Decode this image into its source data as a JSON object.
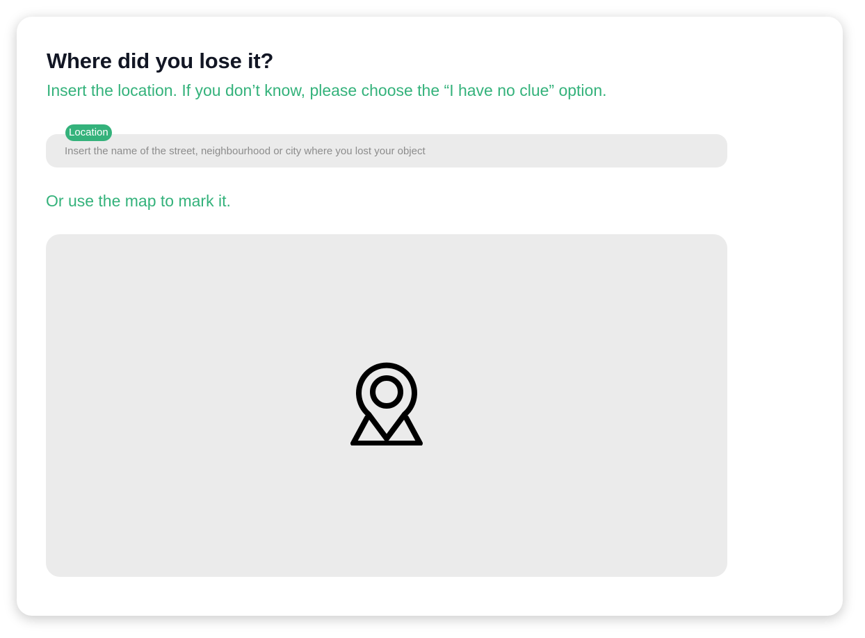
{
  "heading": {
    "title": "Where did you lose it?",
    "subtitle": "Insert the location. If you don’t know, please choose the “I have no clue” option."
  },
  "location_field": {
    "label": "Location",
    "placeholder": "Insert the name of the street, neighbourhood or city where you lost your object",
    "value": ""
  },
  "map_section": {
    "prompt": "Or use the map to mark it.",
    "icon": "map-pin-icon"
  },
  "colors": {
    "accent": "#34b27b",
    "title": "#121624",
    "field_background": "#ebebeb",
    "placeholder": "#8c8c8c"
  }
}
